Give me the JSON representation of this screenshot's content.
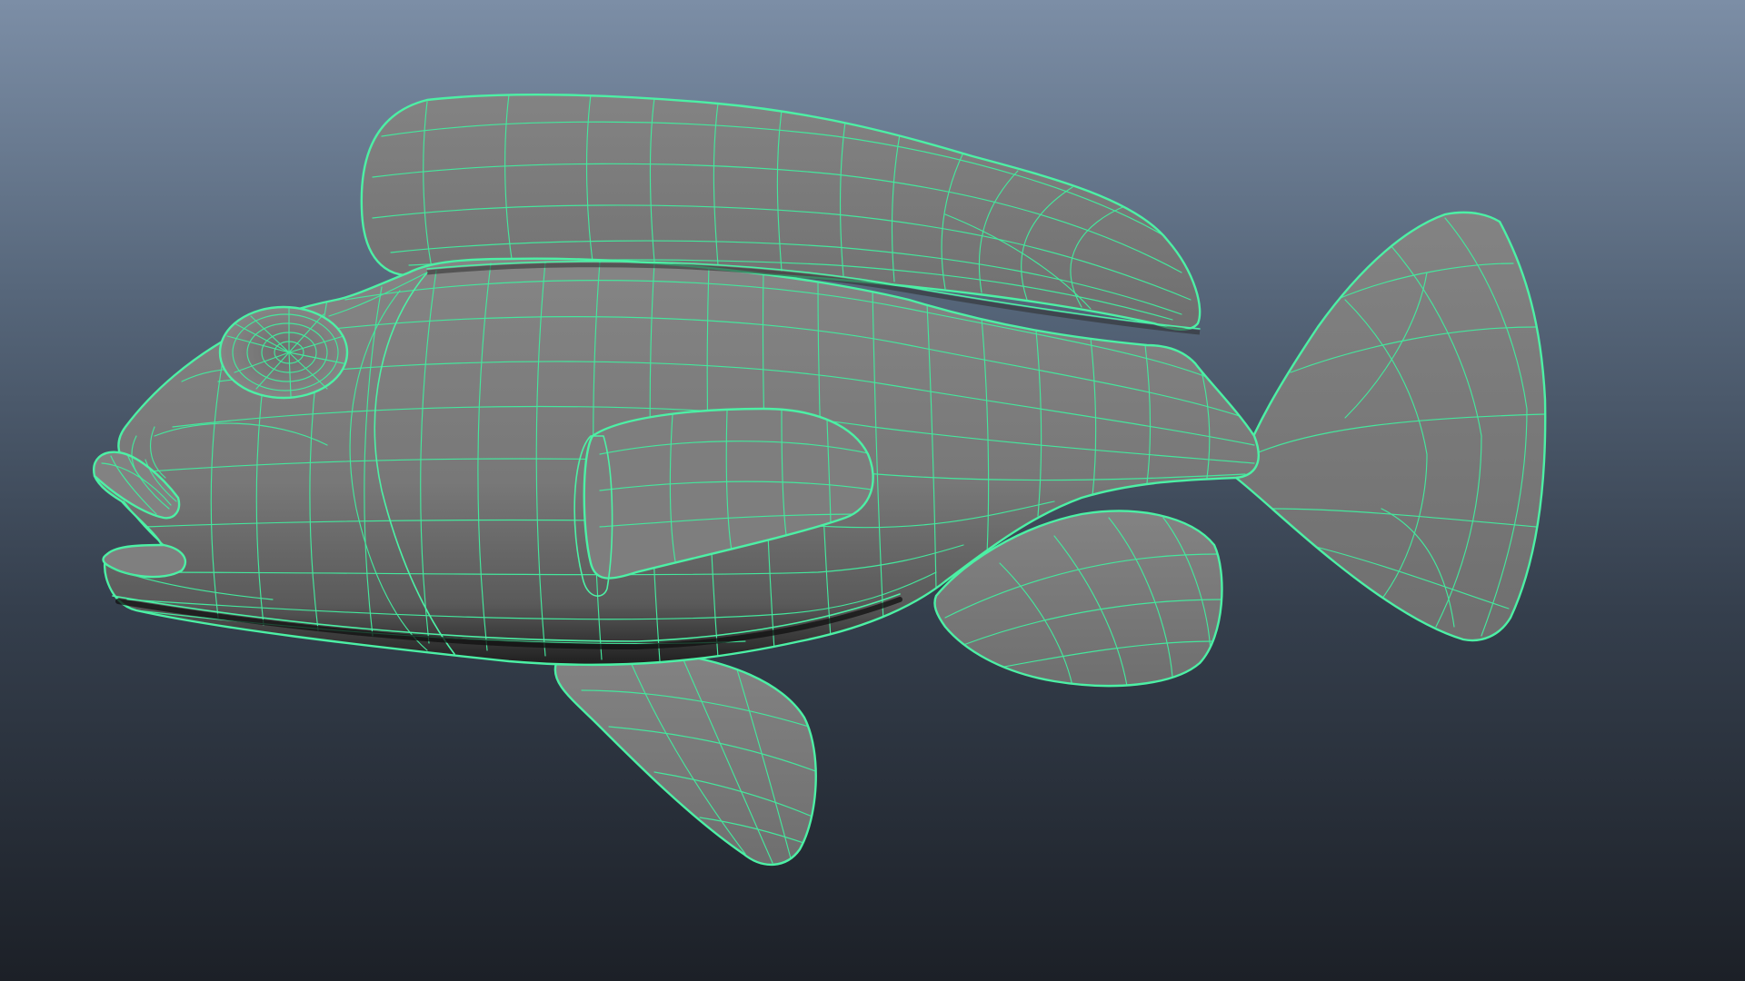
{
  "viewport": {
    "background_top": "#7c8ea6",
    "background_bottom": "#1c2027",
    "wireframe_color": "#4cf0a5",
    "surface_color": "#7a7a7a",
    "object": "fish-model-wireframe-on-shaded"
  }
}
